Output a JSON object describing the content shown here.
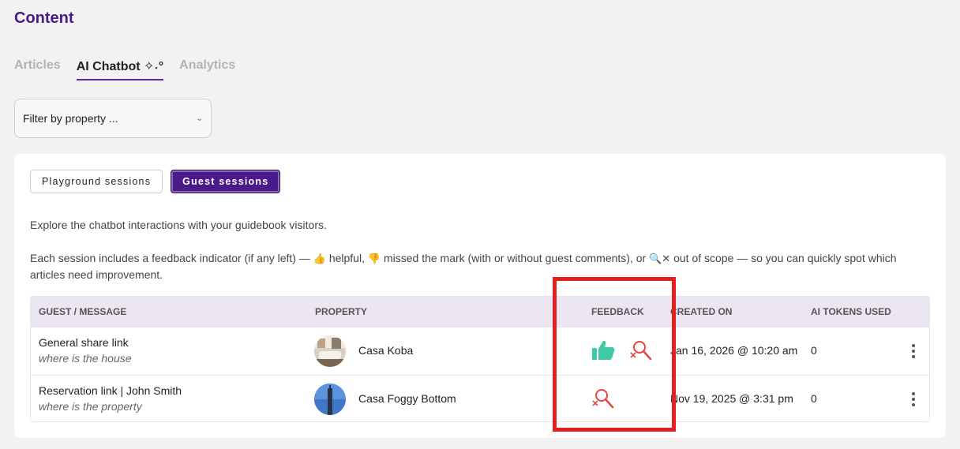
{
  "page": {
    "title": "Content"
  },
  "tabs": [
    {
      "label": "Articles",
      "active": false
    },
    {
      "label": "AI Chatbot ✧˖°",
      "active": true
    },
    {
      "label": "Analytics",
      "active": false
    }
  ],
  "filter": {
    "placeholder": "Filter by property ..."
  },
  "segments": {
    "playground": "Playground sessions",
    "guest": "Guest sessions",
    "active": "guest"
  },
  "intro": "Explore the chatbot interactions with your guidebook visitors.",
  "legend": {
    "part1": "Each session includes a feedback indicator (if any left) —",
    "helpful_emoji": "👍",
    "helpful": "helpful,",
    "missed_emoji": "👎",
    "missed": "missed the mark (with or without guest comments), or",
    "scope_emoji": "🔍✕",
    "scope": "out of scope — so you can quickly spot which articles need improvement."
  },
  "table": {
    "headers": {
      "guest": "Guest / Message",
      "property": "Property",
      "feedback": "Feedback",
      "created": "Created On",
      "tokens": "AI Tokens Used"
    },
    "rows": [
      {
        "title": "General share link",
        "message": "where is the house",
        "property": "Casa Koba",
        "feedback": [
          "thumbs-up",
          "out-of-scope"
        ],
        "created": "Jan 16, 2026 @ 10:20 am",
        "tokens": "0"
      },
      {
        "title": "Reservation link | John Smith",
        "message": "where is the property",
        "property": "Casa Foggy Bottom",
        "feedback": [
          "out-of-scope"
        ],
        "created": "Nov 19, 2025 @ 3:31 pm",
        "tokens": "0"
      }
    ]
  },
  "colors": {
    "brand": "#4a1a8a",
    "helpful": "#3fc9a6",
    "out_of_scope": "#e8443f",
    "highlight": "#e41f1f"
  }
}
